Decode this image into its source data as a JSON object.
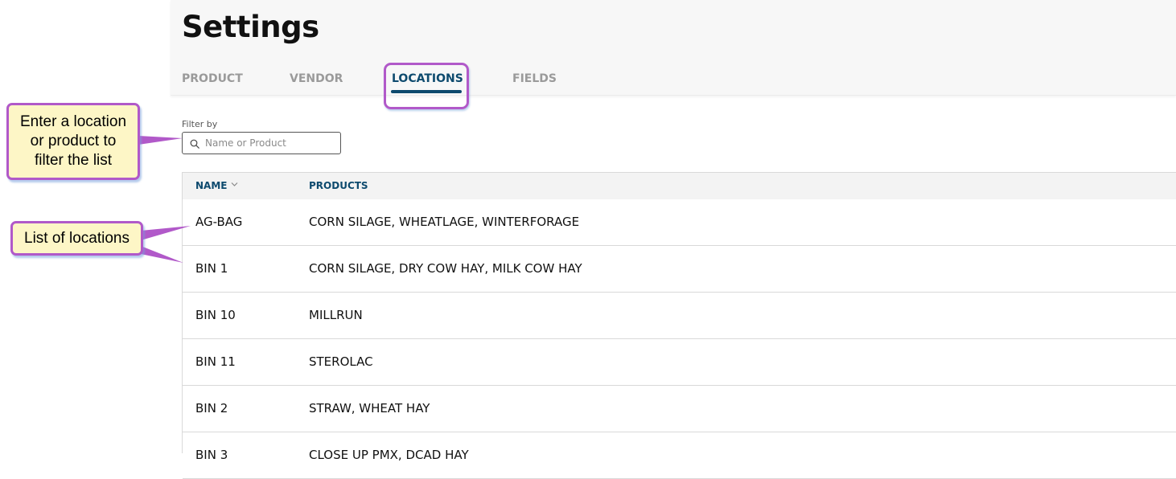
{
  "header": {
    "title": "Settings"
  },
  "tabs": [
    {
      "label": "PRODUCT",
      "active": false
    },
    {
      "label": "VENDOR",
      "active": false
    },
    {
      "label": "LOCATIONS",
      "active": true
    },
    {
      "label": "FIELDS",
      "active": false
    }
  ],
  "filter": {
    "label": "Filter by",
    "placeholder": "Name or Product",
    "value": ""
  },
  "table": {
    "columns": [
      "NAME",
      "PRODUCTS"
    ],
    "sort_icon": "chevron-down-icon",
    "rows": [
      {
        "name": "AG-BAG",
        "products": "CORN SILAGE, WHEATLAGE, WINTERFORAGE"
      },
      {
        "name": "BIN 1",
        "products": "CORN SILAGE, DRY COW HAY, MILK COW HAY"
      },
      {
        "name": "BIN 10",
        "products": "MILLRUN"
      },
      {
        "name": "BIN 11",
        "products": "STEROLAC"
      },
      {
        "name": "BIN 2",
        "products": "STRAW, WHEAT HAY"
      },
      {
        "name": "BIN 3",
        "products": "CLOSE UP PMX, DCAD HAY"
      }
    ]
  },
  "callouts": {
    "filter_hint_line1": "Enter a location",
    "filter_hint_line2": "or product to",
    "filter_hint_line3": "filter the list",
    "list_hint": "List of locations"
  },
  "colors": {
    "accent": "#0d4a6e",
    "inactive_tab": "#9a9a9a",
    "callout_border": "#b159c9",
    "callout_fill": "#fdf6c6"
  }
}
